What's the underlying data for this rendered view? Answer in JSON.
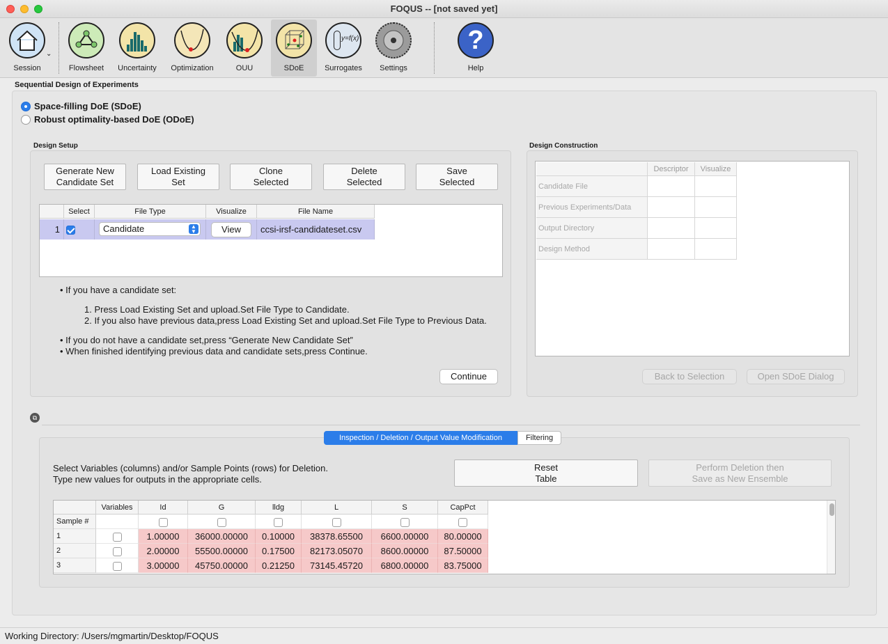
{
  "window": {
    "title": "FOQUS -- [not saved yet]"
  },
  "toolbar": {
    "items": [
      {
        "label": "Session"
      },
      {
        "label": "Flowsheet"
      },
      {
        "label": "Uncertainty"
      },
      {
        "label": "Optimization"
      },
      {
        "label": "OUU"
      },
      {
        "label": "SDoE"
      },
      {
        "label": "Surrogates"
      },
      {
        "label": "Settings"
      },
      {
        "label": "Help"
      }
    ],
    "active": "SDoE",
    "surrogates_icon_text": "y=f(x)",
    "help_icon_text": "?"
  },
  "main": {
    "title": "Sequential Design of Experiments",
    "radio_options": [
      {
        "label": "Space-filling DoE (SDoE)",
        "checked": true
      },
      {
        "label": "Robust optimality-based DoE (ODoE)",
        "checked": false
      }
    ]
  },
  "design_setup": {
    "title": "Design Setup",
    "buttons": {
      "generate": "Generate New\nCandidate Set",
      "load": "Load Existing\nSet",
      "clone": "Clone\nSelected",
      "delete": "Delete\nSelected",
      "save": "Save\nSelected"
    },
    "table": {
      "headers": [
        "Select",
        "File Type",
        "Visualize",
        "File Name"
      ],
      "rows": [
        {
          "num": "1",
          "checked": true,
          "file_type": "Candidate",
          "visualize": "View",
          "file_name": "ccsi-irsf-candidateset.csv"
        }
      ]
    },
    "instructions": {
      "line1": "If you have a candidate set:",
      "step1": "1. Press Load Existing Set and upload.Set File Type to Candidate.",
      "step2": "2. If you also have previous data,press Load Existing Set and upload.Set File Type to Previous Data.",
      "line2": "If you do not have a candidate set,press “Generate New Candidate Set”",
      "line3": "When finished identifying previous data and candidate sets,press Continue."
    },
    "continue_label": "Continue"
  },
  "design_construction": {
    "title": "Design Construction",
    "headers": [
      "Descriptor",
      "Visualize"
    ],
    "rows": [
      "Candidate File",
      "Previous Experiments/Data",
      "Output Directory",
      "Design Method"
    ],
    "back_label": "Back to Selection",
    "open_label": "Open SDoE Dialog"
  },
  "inspection": {
    "tabs": [
      {
        "label": "Inspection / Deletion / Output Value Modification",
        "active": true
      },
      {
        "label": "Filtering",
        "active": false
      }
    ],
    "instruction_line1": "Select Variables (columns) and/or Sample Points (rows) for Deletion.",
    "instruction_line2": "Type new values for outputs in the appropriate cells.",
    "reset_label": "Reset\nTable",
    "perform_label": "Perform Deletion then\nSave as New Ensemble",
    "table": {
      "corner": "Sample #",
      "headers": [
        "Variables",
        "Id",
        "G",
        "lldg",
        "L",
        "S",
        "CapPct"
      ],
      "rows": [
        {
          "num": "1",
          "values": [
            "1.00000",
            "36000.00000",
            "0.10000",
            "38378.65500",
            "6600.00000",
            "80.00000"
          ]
        },
        {
          "num": "2",
          "values": [
            "2.00000",
            "55500.00000",
            "0.17500",
            "82173.05070",
            "8600.00000",
            "87.50000"
          ]
        },
        {
          "num": "3",
          "values": [
            "3.00000",
            "45750.00000",
            "0.21250",
            "73145.45720",
            "6800.00000",
            "83.75000"
          ]
        }
      ]
    }
  },
  "status": {
    "text": "Working Directory: /Users/mgmartin/Desktop/FOQUS"
  },
  "colors": {
    "accent": "#2b7de9",
    "highlight_row": "#c9c9f0",
    "data_cell": "#f6c9c9"
  }
}
